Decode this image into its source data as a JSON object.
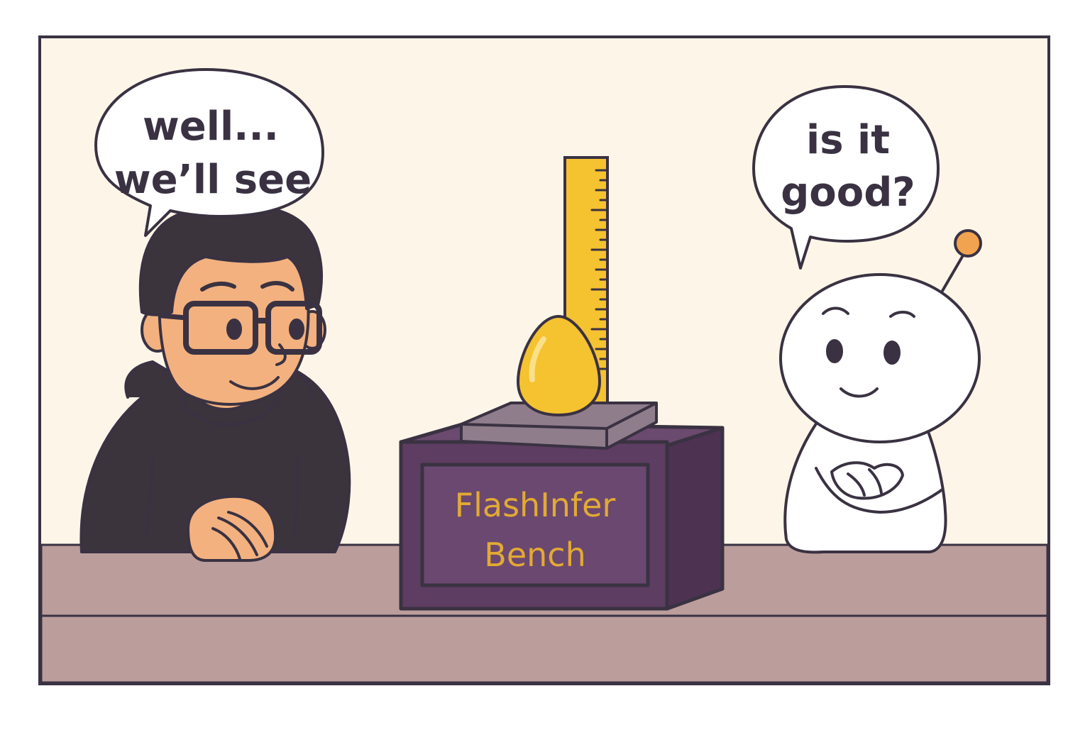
{
  "left_bubble": {
    "line1": "well...",
    "line2": "we’ll see"
  },
  "right_bubble": {
    "line1": "is it",
    "line2": "good?"
  },
  "box_label": {
    "line1": "FlashInfer",
    "line2": "Bench"
  },
  "colors": {
    "background": "#fdf6e8",
    "outline": "#3a3242",
    "counter": "#bb9e9c",
    "box_purple": "#5d3d62",
    "box_label_text": "#e2aa33",
    "gold": "#f5c230",
    "hoodie": "#3b343c",
    "skin": "#f3b17f"
  }
}
